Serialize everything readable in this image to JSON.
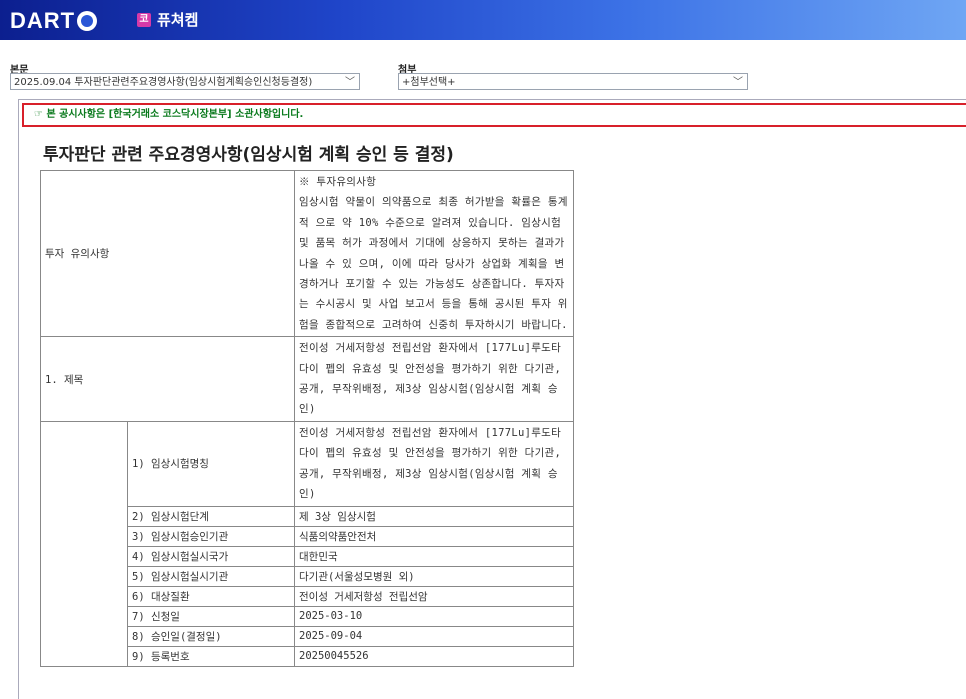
{
  "header": {
    "logo_text": "DART",
    "company_badge": "코",
    "company_name": "퓨쳐켐"
  },
  "selectors": {
    "main_label": "본문",
    "main_value": "2025.09.04  투자판단관련주요경영사항(임상시험계획승인신청등결정)",
    "attach_label": "첨부",
    "attach_value": "+첨부선택+"
  },
  "notice": "☞ 본 공시사항은 [한국거래소 코스닥시장본부] 소관사항입니다.",
  "document": {
    "title": "투자판단 관련 주요경영사항(임상시험 계획 승인 등 결정)",
    "caution_label": "투자 유의사항",
    "caution_text": "※ 투자유의사항\n임상시험 약물이 의약품으로 최종 허가받을 확률은 통계적 으로 약 10% 수준으로 알려져 있습니다. 임상시험 및 품목 허가 과정에서 기대에 상응하지 못하는 결과가 나올 수 있 으며, 이에 따라 당사가 상업화 계획을 변경하거나 포기할 수 있는 가능성도 상존합니다. 투자자는 수시공시 및 사업 보고서 등을 통해 공시된 투자 위험을 종합적으로 고려하여 신중히 투자하시기 바랍니다.",
    "title_row_label": "1. 제목",
    "title_row_value": "전이성 거세저항성 전립선암 환자에서 [177Lu]루도타다이 펩의 유효성 및 안전성을 평가하기 위한 다기관, 공개, 무작위배정, 제3상 임상시험(임상시험 계획 승인)",
    "rows": [
      {
        "label": "1) 임상시험명칭",
        "value": "전이성 거세저항성 전립선암 환자에서 [177Lu]루도타다이 펩의 유효성 및 안전성을 평가하기 위한 다기관, 공개, 무작위배정, 제3상 임상시험(임상시험 계획 승인)"
      },
      {
        "label": "2) 임상시험단계",
        "value": "제 3상 임상시험"
      },
      {
        "label": "3) 임상시험승인기관",
        "value": "식품의약품안전처"
      },
      {
        "label": "4) 임상시험실시국가",
        "value": "대한민국"
      },
      {
        "label": "5) 임상시험실시기관",
        "value": "다기관(서울성모병원 외)"
      },
      {
        "label": "6) 대상질환",
        "value": "전이성 거세저항성 전립선암"
      },
      {
        "label": "7) 신청일",
        "value": "2025-03-10"
      },
      {
        "label": "8) 승인일(결정일)",
        "value": "2025-09-04"
      },
      {
        "label": "9) 등록번호",
        "value": "20250045526"
      }
    ]
  },
  "colors": {
    "header_start": "#0c1f8f",
    "header_end": "#6fa6f4",
    "notice_border": "#d8202a",
    "notice_text": "#0a7a1d"
  }
}
